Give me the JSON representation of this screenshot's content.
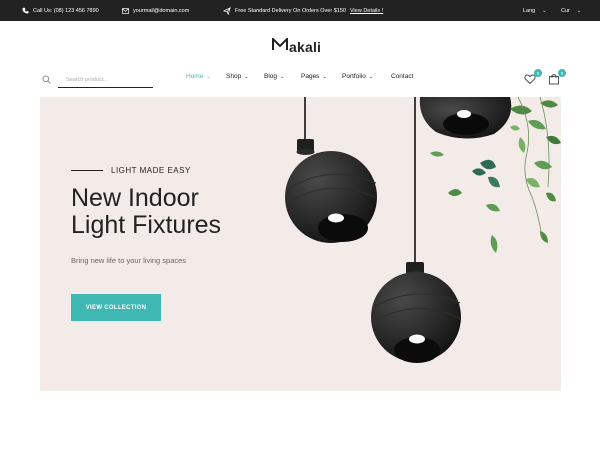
{
  "topbar": {
    "phone": "Call Us: (08) 123 456 7890",
    "email": "yourmail@domain.com",
    "promo_text": "Free Standard Delivery On Orders Over $150",
    "promo_link": "View Details !",
    "language": "Lang",
    "currency": "Cur"
  },
  "logo": {
    "text": "akali"
  },
  "search": {
    "placeholder": "Search product..."
  },
  "nav": {
    "items": [
      {
        "label": "Home"
      },
      {
        "label": "Shop"
      },
      {
        "label": "Blog"
      },
      {
        "label": "Pages"
      },
      {
        "label": "Portfolio"
      },
      {
        "label": "Contact"
      }
    ]
  },
  "header_icons": {
    "wishlist_count": "0",
    "cart_count": "0"
  },
  "hero": {
    "eyebrow": "LIGHT MADE EASY",
    "headline_line1": "New Indoor",
    "headline_line2": "Light Fixtures",
    "subtitle": "Bring new life to your living spaces",
    "cta_label": "VIEW COLLECTION"
  },
  "colors": {
    "accent": "#3fb8b4",
    "topbar_bg": "#222222",
    "hero_bg": "#f3ebe7"
  }
}
